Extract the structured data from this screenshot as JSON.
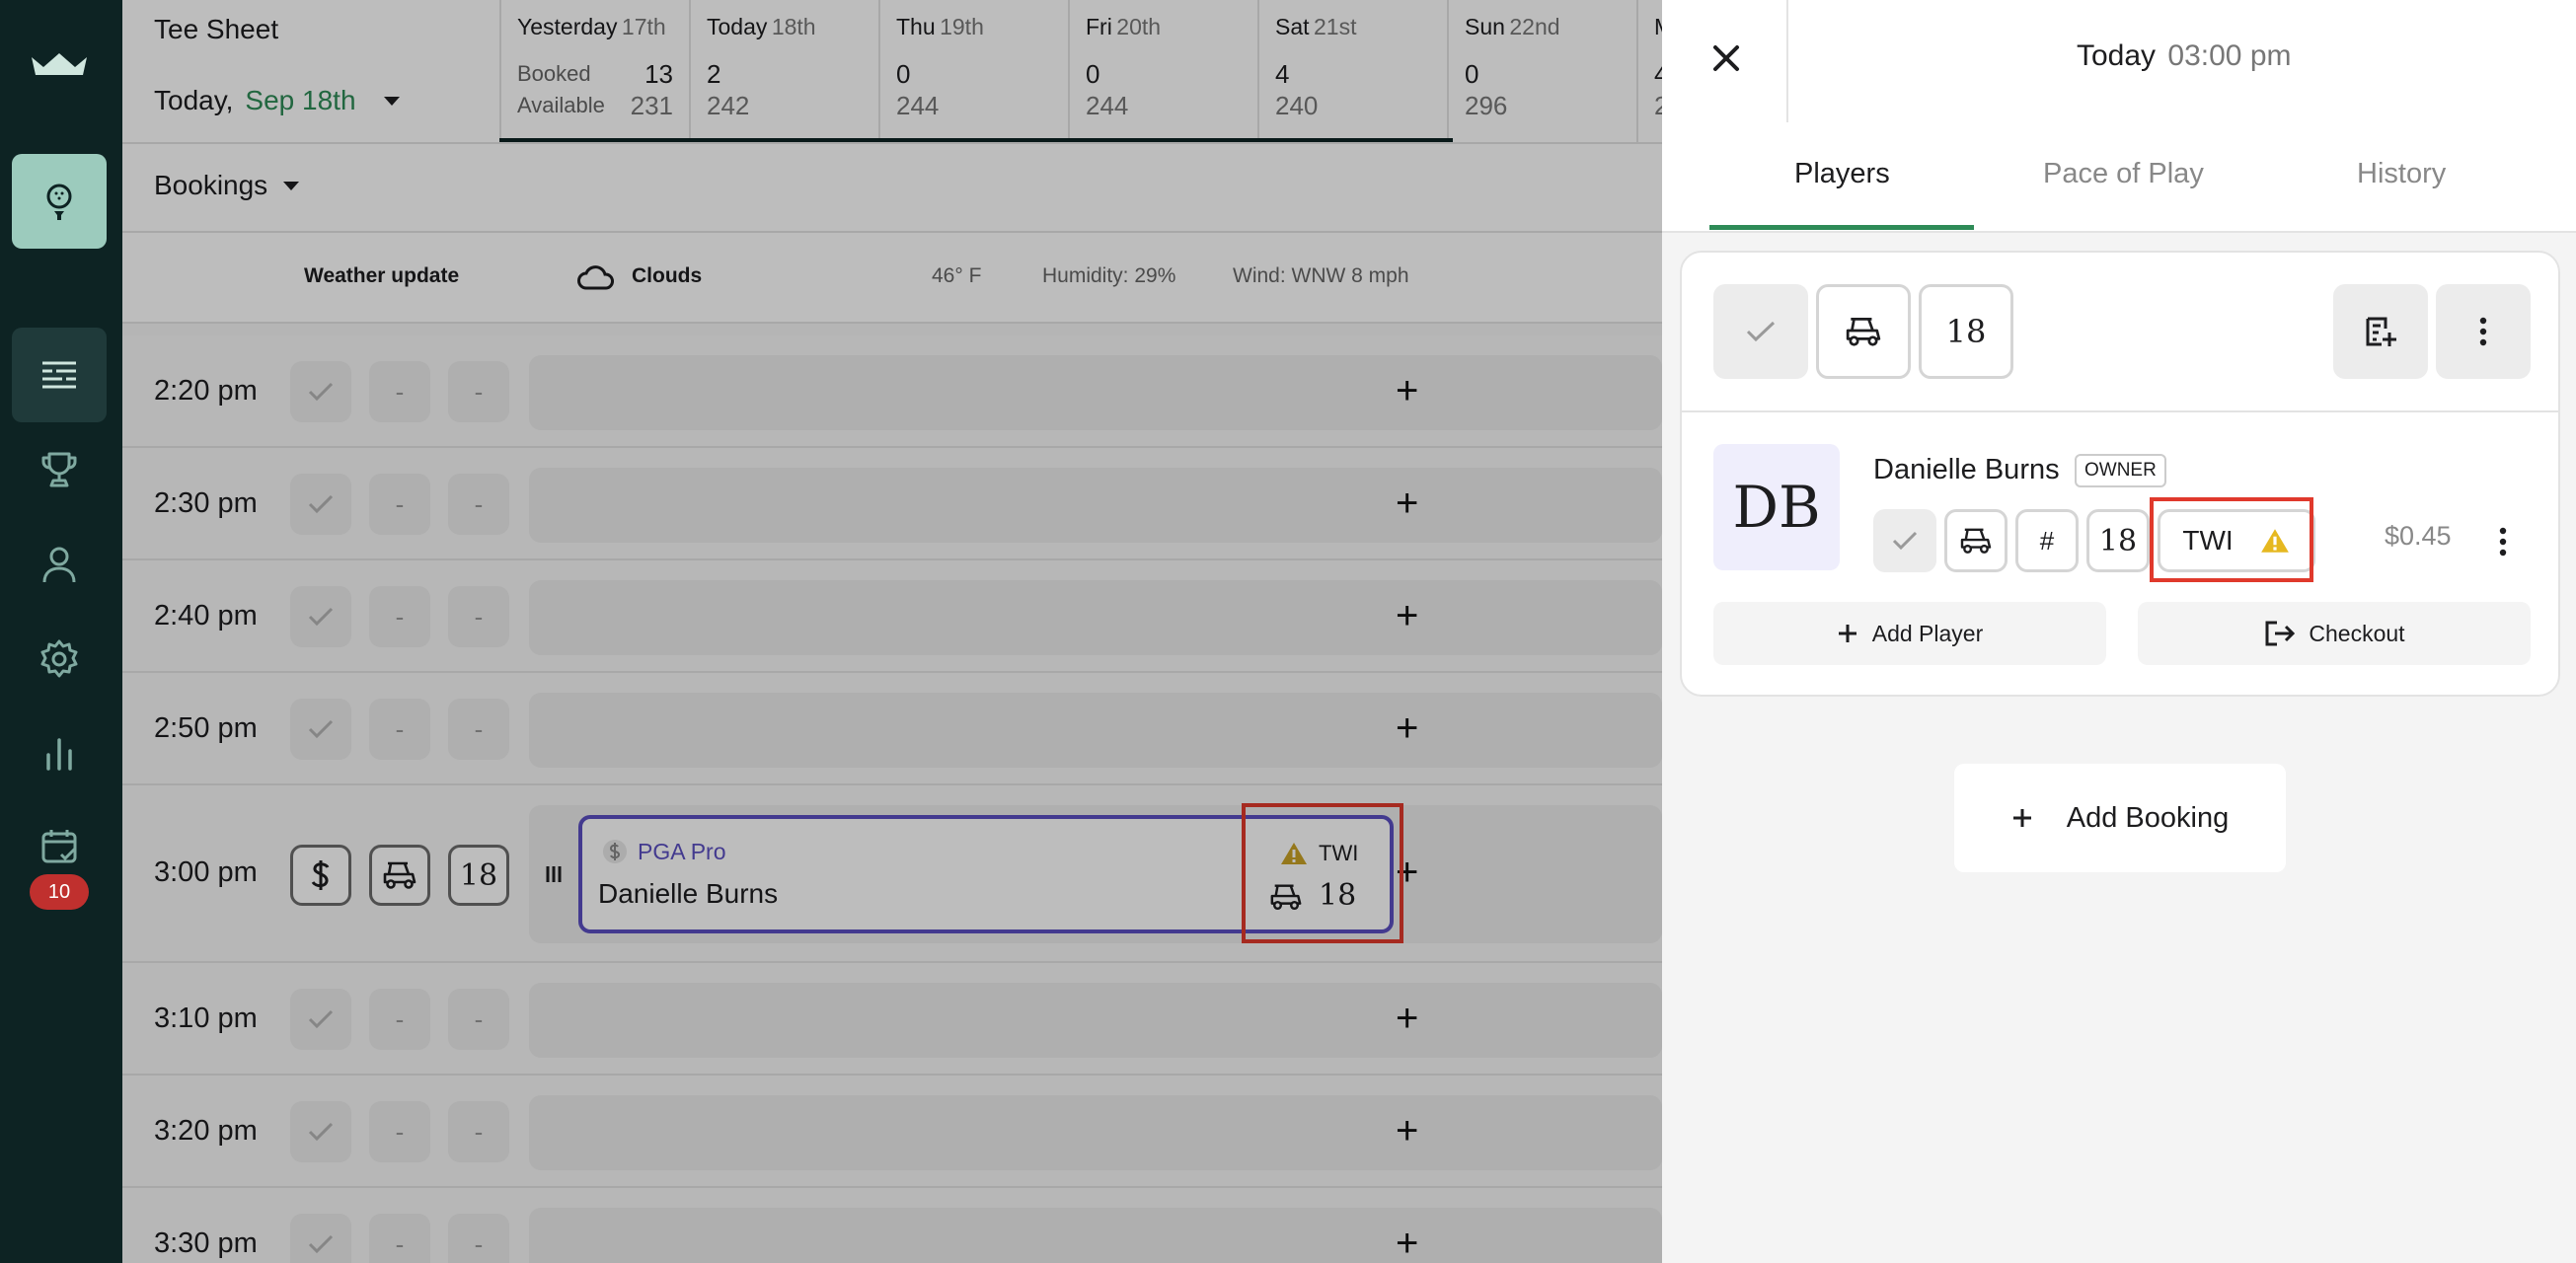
{
  "sidebar": {
    "logo_icon": "crown-logo-icon",
    "items": [
      {
        "icon": "golf-ball-tee-icon",
        "active": false
      },
      {
        "icon": "tee-sheet-icon",
        "active": true
      },
      {
        "icon": "trophy-icon",
        "active": false
      },
      {
        "icon": "user-icon",
        "active": false
      },
      {
        "icon": "gear-icon",
        "active": false
      },
      {
        "icon": "bar-chart-icon",
        "active": false
      },
      {
        "icon": "calendar-check-icon",
        "active": false
      }
    ],
    "calendar_badge": "10"
  },
  "header": {
    "title": "Tee Sheet",
    "date_prefix": "Today,",
    "date_value": "Sep 18th",
    "days": [
      {
        "name": "Yesterday",
        "num": "17th",
        "booked_label": "Booked",
        "available_label": "Available",
        "booked": "13",
        "available": "231"
      },
      {
        "name": "Today",
        "num": "18th",
        "booked": "2",
        "available": "242"
      },
      {
        "name": "Thu",
        "num": "19th",
        "booked": "0",
        "available": "244"
      },
      {
        "name": "Fri",
        "num": "20th",
        "booked": "0",
        "available": "244"
      },
      {
        "name": "Sat",
        "num": "21st",
        "booked": "4",
        "available": "240"
      },
      {
        "name": "Sun",
        "num": "22nd",
        "booked": "0",
        "available": "296"
      },
      {
        "name": "M",
        "num": "",
        "booked": "4",
        "available": "2"
      }
    ]
  },
  "bookings_filter": "Bookings",
  "weather": {
    "label": "Weather update",
    "condition": "Clouds",
    "temp": "46° F",
    "humidity": "Humidity: 29%",
    "wind": "Wind: WNW 8 mph"
  },
  "slots": [
    {
      "time": "2:20 pm"
    },
    {
      "time": "2:30 pm"
    },
    {
      "time": "2:40 pm"
    },
    {
      "time": "2:50 pm"
    },
    {
      "time": "3:00 pm"
    },
    {
      "time": "3:10 pm"
    },
    {
      "time": "3:20 pm"
    },
    {
      "time": "3:30 pm"
    }
  ],
  "slot_chip_dash": "-",
  "slot_plus": "+",
  "booking": {
    "rate": "PGA Pro",
    "player": "Danielle Burns",
    "tag": "TWI",
    "holes": "18",
    "chip_holes": "18"
  },
  "panel": {
    "day": "Today",
    "time": "03:00 pm",
    "tabs": [
      "Players",
      "Pace of Play",
      "History"
    ],
    "group_holes": "18",
    "player": {
      "initials": "DB",
      "name": "Danielle Burns",
      "role": "OWNER",
      "hash": "#",
      "holes": "18",
      "tag": "TWI",
      "price": "$0.45"
    },
    "add_player": "Add Player",
    "checkout": "Checkout",
    "add_booking": "Add Booking"
  },
  "colors": {
    "nav_bg": "#0d2323",
    "accent_green": "#2e8b57",
    "booking_border": "#5b4fc1",
    "highlight_red": "#e0392c",
    "warning_yellow": "#e6b820"
  }
}
